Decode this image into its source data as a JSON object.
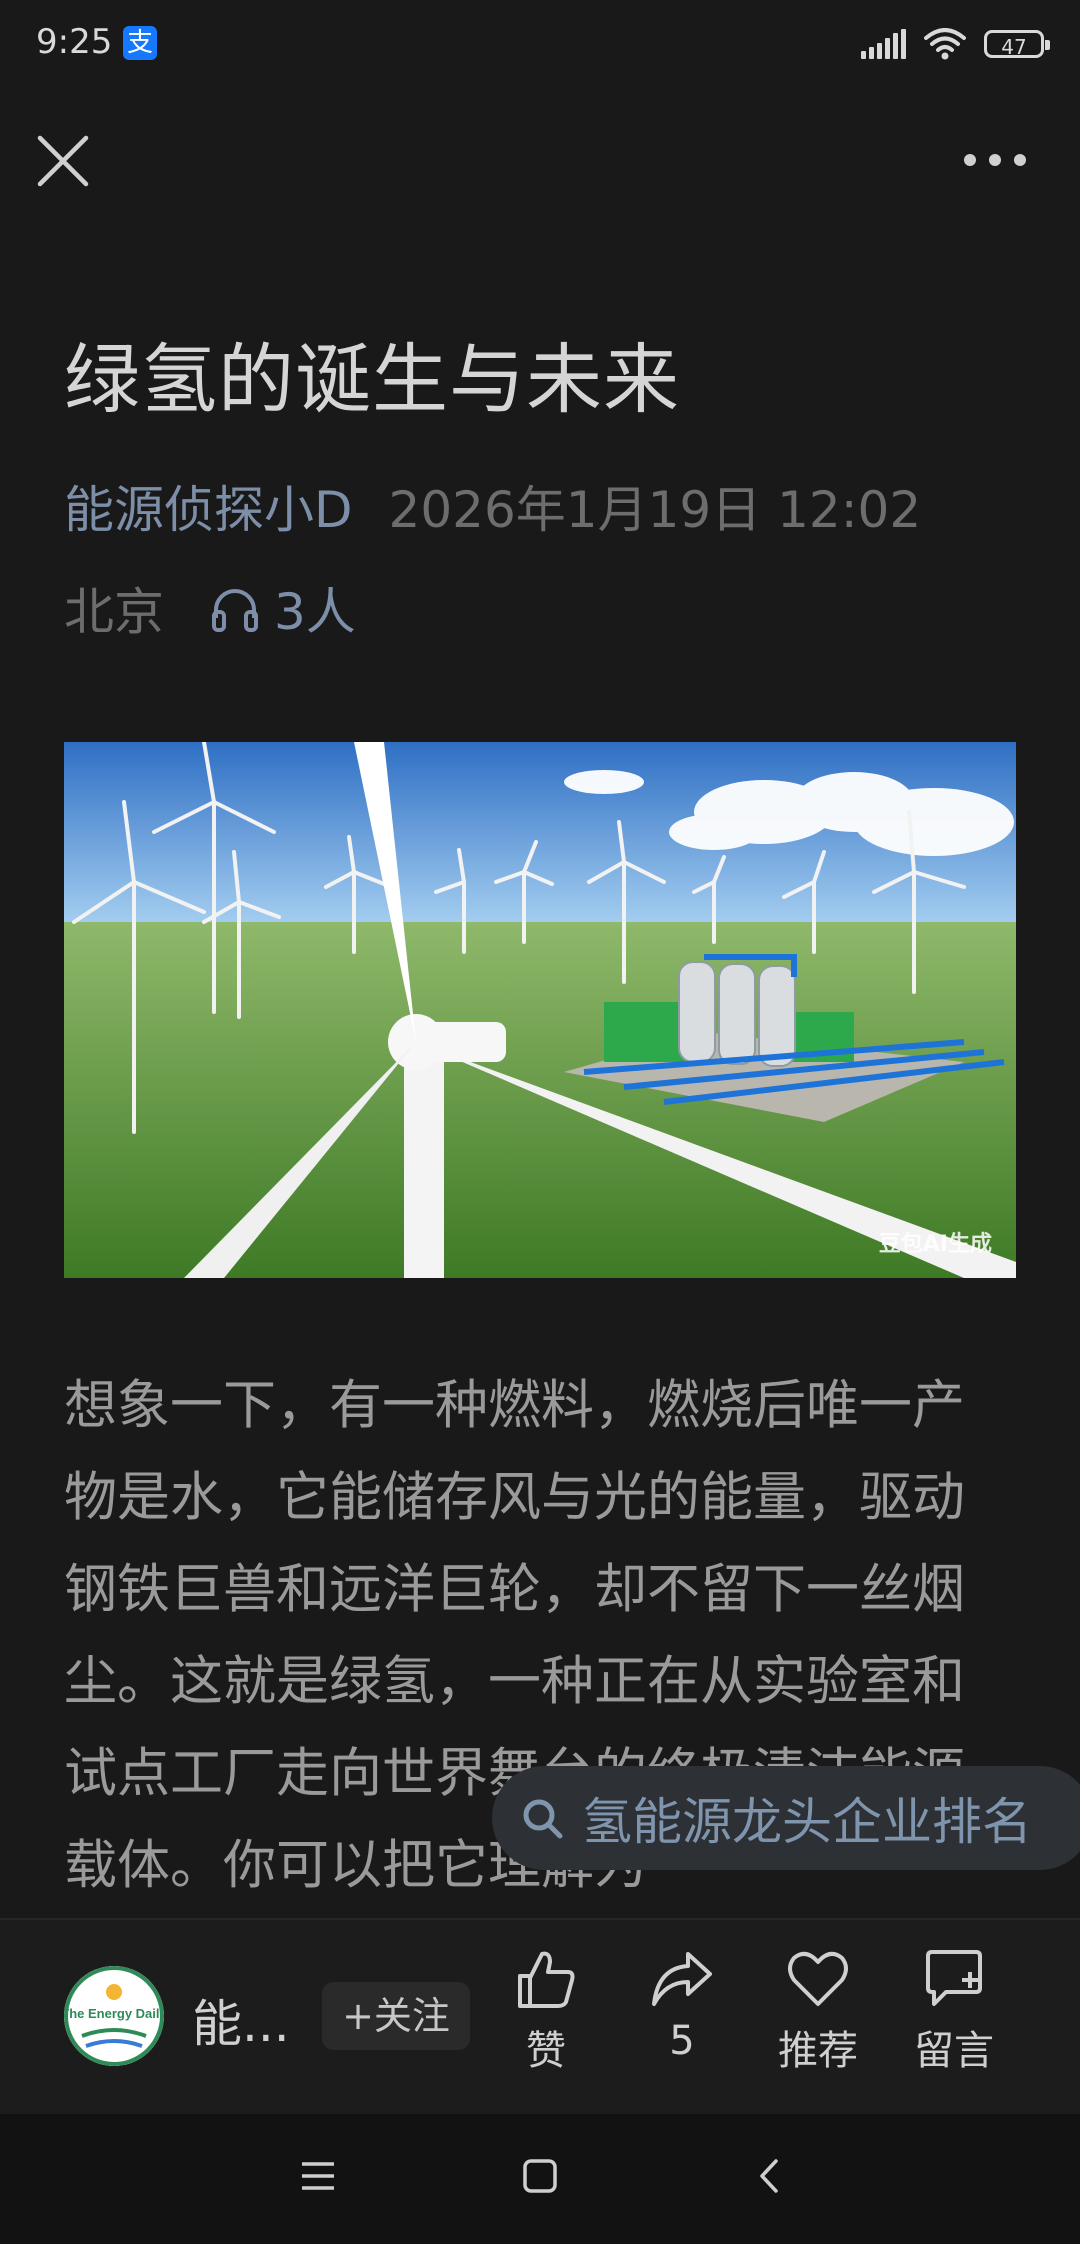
{
  "status_bar": {
    "time": "9:25",
    "alipay_glyph": "支",
    "battery": "47",
    "icons": [
      "alipay-icon",
      "signal-icon",
      "wifi-icon",
      "battery-icon"
    ]
  },
  "nav": {
    "close_icon": "close-icon",
    "more_icon": "more-icon"
  },
  "article": {
    "title": "绿氢的诞生与未来",
    "author": "能源侦探小D",
    "date": "2026年1月19日 12:02",
    "location": "北京",
    "listeners": "3人",
    "image_watermark": "豆包AI生成",
    "body": "想象一下，有一种燃料，燃烧后唯一产物是水，它能储存风与光的能量，驱动钢铁巨兽和远洋巨轮，却不留下一丝烟尘。这就是绿氢，一种正在从实验室和试点工厂走向世界舞台的终极清洁能源载体。你可以把它理解为"
  },
  "search_suggestion": {
    "text": "氢能源龙头企业排名"
  },
  "bottom_bar": {
    "account_name": "能...",
    "avatar_text": "The Energy Daily",
    "follow_label": "+关注",
    "like_label": "赞",
    "share_count": "5",
    "recommend_label": "推荐",
    "comment_label": "留言"
  },
  "colors": {
    "background": "#191919",
    "link": "#7d8fa8",
    "muted": "#6d6d6d"
  }
}
